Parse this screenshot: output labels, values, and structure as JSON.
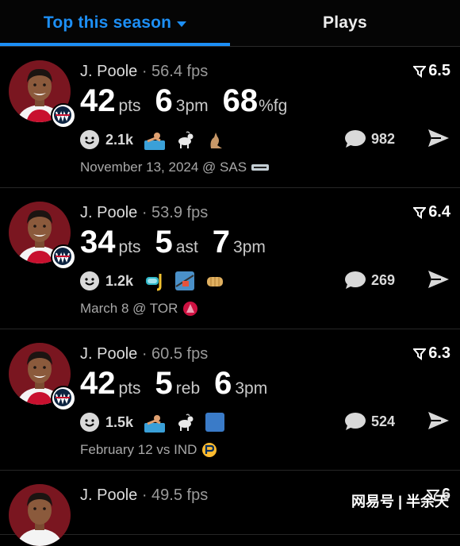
{
  "tabs": {
    "active_label": "Top this season",
    "inactive_label": "Plays"
  },
  "accent_color": "#1d8ff5",
  "cards": [
    {
      "player": "J. Poole",
      "fps": "56.4 fps",
      "rating": "6.5",
      "stats": [
        {
          "value": "42",
          "unit": "pts"
        },
        {
          "value": "6",
          "unit": "3pm"
        },
        {
          "value": "68",
          "unit": "%fg"
        }
      ],
      "reaction_count": "2.1k",
      "reaction_emojis": [
        "swimmer-emoji",
        "goat-emoji",
        "kangaroo-emoji"
      ],
      "comment_count": "982",
      "date": "November 13, 2024 @ SAS",
      "opponent_logo": "spurs-logo"
    },
    {
      "player": "J. Poole",
      "fps": "53.9 fps",
      "rating": "6.4",
      "stats": [
        {
          "value": "34",
          "unit": "pts"
        },
        {
          "value": "5",
          "unit": "ast"
        },
        {
          "value": "7",
          "unit": "3pm"
        }
      ],
      "reaction_count": "1.2k",
      "reaction_emojis": [
        "diving-mask-emoji",
        "ski-lift-emoji",
        "fist-emoji"
      ],
      "comment_count": "269",
      "date": "March 8 @ TOR",
      "opponent_logo": "raptors-logo"
    },
    {
      "player": "J. Poole",
      "fps": "60.5 fps",
      "rating": "6.3",
      "stats": [
        {
          "value": "42",
          "unit": "pts"
        },
        {
          "value": "5",
          "unit": "reb"
        },
        {
          "value": "6",
          "unit": "3pm"
        }
      ],
      "reaction_count": "1.5k",
      "reaction_emojis": [
        "swimmer-emoji",
        "goat-emoji",
        "blue-square-emoji"
      ],
      "comment_count": "524",
      "date": "February 12 vs IND",
      "opponent_logo": "pacers-logo"
    },
    {
      "player": "J. Poole",
      "fps": "49.5 fps",
      "rating": "6"
    }
  ],
  "watermark": "网易号 | 半余天"
}
